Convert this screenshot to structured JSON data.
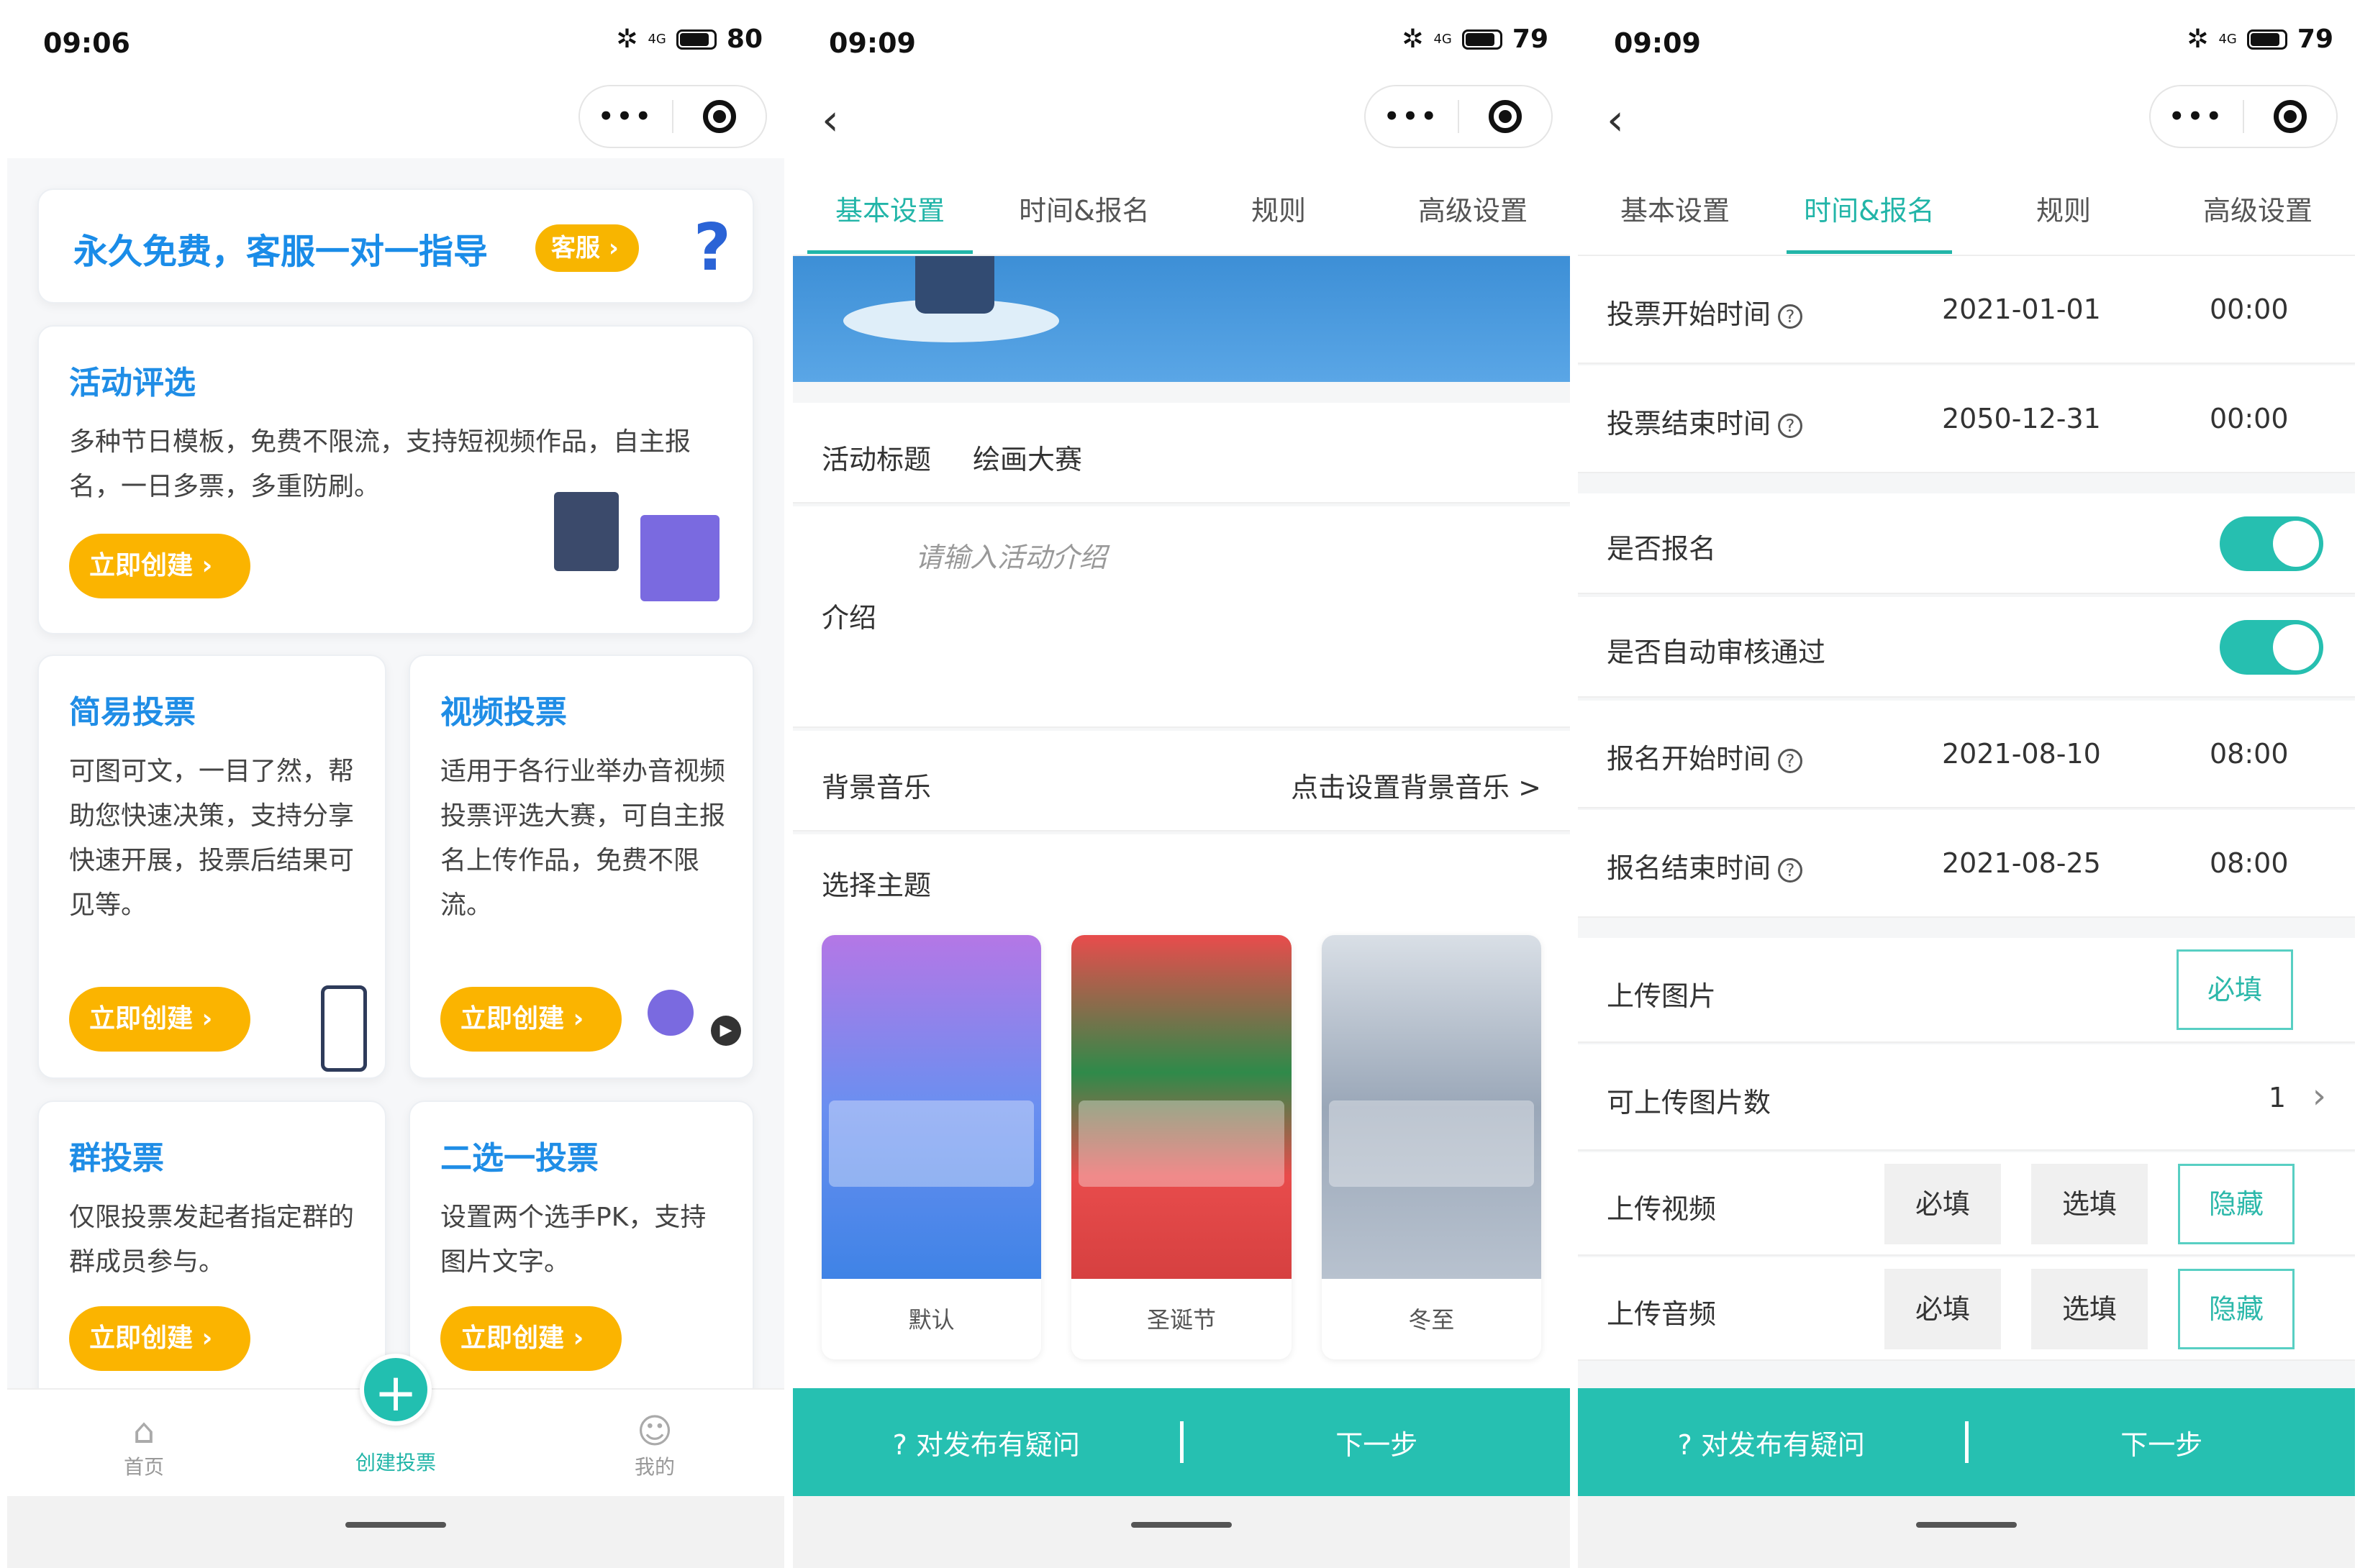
{
  "left": {
    "status": {
      "time": "09:06",
      "battery": "80",
      "network": "4G"
    },
    "banner": {
      "text": "永久免费，客服一对一指导",
      "badge": "客服"
    },
    "cards": [
      {
        "title": "活动评选",
        "desc": "多种节日模板，免费不限流，支持短视频作品，自主报名，一日多票，多重防刷。",
        "button": "立即创建"
      },
      {
        "title": "简易投票",
        "desc": "可图可文，一目了然，帮助您快速决策，支持分享快速开展，投票后结果可见等。",
        "button": "立即创建"
      },
      {
        "title": "视频投票",
        "desc": "适用于各行业举办音视频投票评选大赛，可自主报名上传作品，免费不限流。",
        "button": "立即创建"
      },
      {
        "title": "群投票",
        "desc": "仅限投票发起者指定群的群成员参与。",
        "button": "立即创建"
      },
      {
        "title": "二选一投票",
        "desc": "设置两个选手PK，支持图片文字。",
        "button": "立即创建"
      }
    ],
    "tabbar": {
      "home": "首页",
      "create": "创建投票",
      "mine": "我的"
    }
  },
  "middle": {
    "status": {
      "time": "09:09",
      "battery": "79",
      "network": "4G"
    },
    "tabs": [
      "基本设置",
      "时间&报名",
      "规则",
      "高级设置"
    ],
    "title_label": "活动标题",
    "title_value": "绘画大赛",
    "intro_label": "介绍",
    "intro_placeholder": "请输入活动介绍",
    "music_label": "背景音乐",
    "music_action": "点击设置背景音乐 >",
    "theme_label": "选择主题",
    "themes": [
      {
        "name": "默认",
        "color": "#6a8ff0"
      },
      {
        "name": "圣诞节",
        "color": "#e84c4c"
      },
      {
        "name": "冬至",
        "color": "#9aa7b8"
      }
    ],
    "footer": {
      "question": "? 对发布有疑问",
      "next": "下一步"
    }
  },
  "right": {
    "status": {
      "time": "09:09",
      "battery": "79",
      "network": "4G"
    },
    "tabs": [
      "基本设置",
      "时间&报名",
      "规则",
      "高级设置"
    ],
    "vote_start": {
      "label": "投票开始时间",
      "date": "2021-01-01",
      "time": "00:00"
    },
    "vote_end": {
      "label": "投票结束时间",
      "date": "2050-12-31",
      "time": "00:00"
    },
    "signup_enabled": {
      "label": "是否报名",
      "on": true
    },
    "auto_approve": {
      "label": "是否自动审核通过",
      "on": true
    },
    "signup_start": {
      "label": "报名开始时间",
      "date": "2021-08-10",
      "time": "08:00"
    },
    "signup_end": {
      "label": "报名结束时间",
      "date": "2021-08-25",
      "time": "08:00"
    },
    "upload_image": {
      "label": "上传图片",
      "option": "必填"
    },
    "image_count": {
      "label": "可上传图片数",
      "value": "1"
    },
    "upload_video": {
      "label": "上传视频",
      "options": [
        "必填",
        "选填",
        "隐藏"
      ]
    },
    "upload_audio": {
      "label": "上传音频",
      "options": [
        "必填",
        "选填",
        "隐藏"
      ]
    },
    "footer": {
      "question": "? 对发布有疑问",
      "next": "下一步"
    }
  },
  "colors": {
    "accent": "#22b5a8",
    "blue_title": "#1f8de6",
    "button_yellow": "#fbb400"
  }
}
